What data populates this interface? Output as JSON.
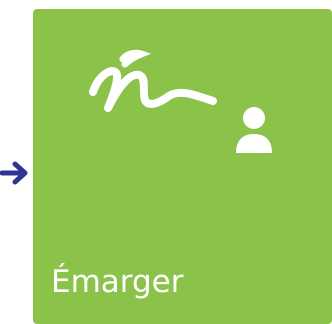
{
  "colors": {
    "tile_bg": "#8bc34a",
    "tile_fg": "#ffffff",
    "arrow": "#2f3595"
  },
  "pointer": {
    "icon": "arrow-right-icon"
  },
  "tile": {
    "label": "Émarger",
    "icons": [
      "signature-icon",
      "person-icon"
    ]
  }
}
